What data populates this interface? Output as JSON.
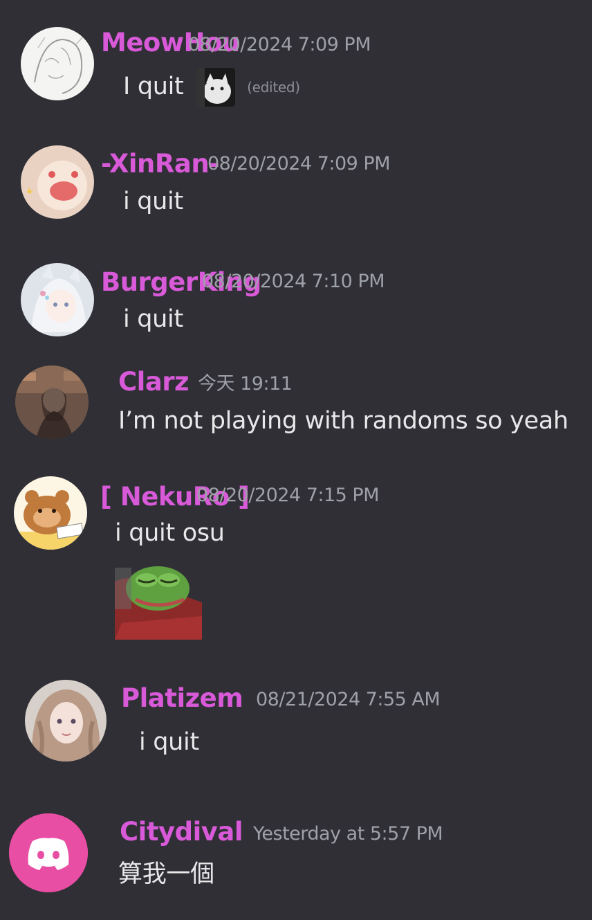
{
  "messages": [
    {
      "username": "MeowHou",
      "timestamp": "08/20/2024 7:09 PM",
      "text": "I quit",
      "edited": "(edited)",
      "has_inline_emoji": true,
      "avatar_icon": "sketch-girl-avatar"
    },
    {
      "username": "-XinRan-",
      "timestamp": "08/20/2024 7:09 PM",
      "text": "i quit",
      "avatar_icon": "pink-creature-avatar"
    },
    {
      "username": "BurgerKing",
      "timestamp": "08/20/2024 7:10 PM",
      "text": "i quit",
      "avatar_icon": "anime-girl-avatar"
    },
    {
      "username": "Clarz",
      "timestamp": "今天 19:11",
      "text": "I’m not playing with randoms so yeah",
      "avatar_icon": "photo-avatar"
    },
    {
      "username": "[ NekuRo ]",
      "timestamp": "08/20/2024 7:15 PM",
      "text": "i quit osu",
      "sticker": "pepe-sleeping-sticker",
      "avatar_icon": "bear-reading-avatar"
    },
    {
      "username": "Platizem",
      "timestamp": "08/21/2024 7:55 AM",
      "text": "i quit",
      "avatar_icon": "anime-portrait-avatar"
    },
    {
      "username": "Citydival",
      "timestamp": "Yesterday at 5:57 PM",
      "text": "算我一個",
      "avatar_icon": "discord-logo-avatar"
    }
  ],
  "colors": {
    "background": "#2f2f35",
    "username": "#d85ad8",
    "timestamp": "#9fa1a8",
    "text": "#e8e8ea",
    "discord_avatar": "#e84ea3"
  }
}
